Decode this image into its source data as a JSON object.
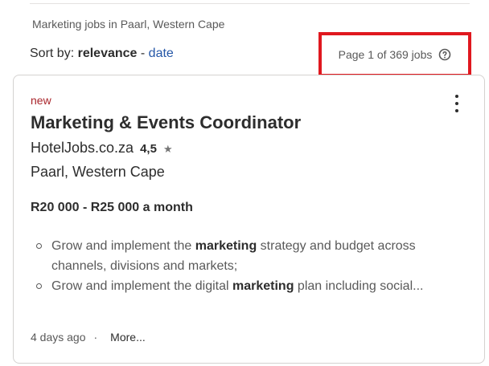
{
  "breadcrumb": "Marketing jobs in Paarl, Western Cape",
  "sort": {
    "label": "Sort by:",
    "active": "relevance",
    "separator": "-",
    "alternate": "date"
  },
  "page_info": {
    "text": "Page 1 of 369 jobs",
    "help_icon": "question-circle-icon",
    "highlight_color": "#e0181f"
  },
  "job": {
    "badge": "new",
    "title": "Marketing & Events Coordinator",
    "company": "HotelJobs.co.za",
    "rating": "4,5",
    "rating_icon": "star-icon",
    "location": "Paarl, Western Cape",
    "salary": "R20 000 - R25 000 a month",
    "snippet": [
      {
        "before": "Grow and implement the ",
        "keyword": "marketing",
        "after": " strategy and budget across channels, divisions and markets;"
      },
      {
        "before": "Grow and implement the digital ",
        "keyword": "marketing",
        "after": " plan including social..."
      }
    ],
    "posted": "4 days ago",
    "dot": "·",
    "more": "More..."
  }
}
